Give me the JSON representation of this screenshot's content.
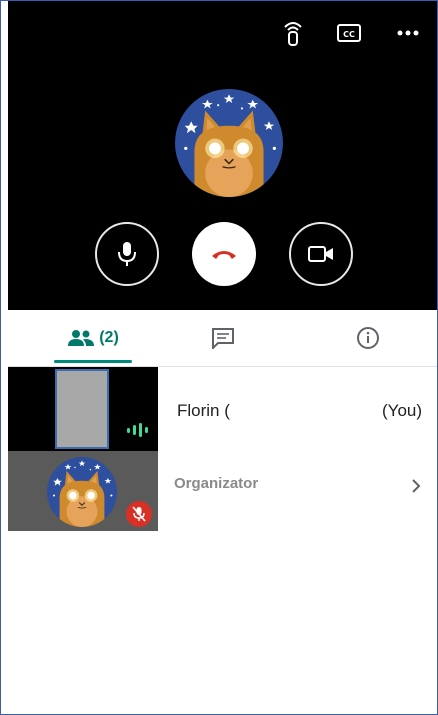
{
  "call": {
    "icons": [
      "live-stream-icon",
      "captions-icon",
      "more-icon"
    ],
    "controls": [
      "microphone-button",
      "end-call-button",
      "camera-button"
    ],
    "colors": {
      "background": "#000000",
      "end_call": "#d93025"
    }
  },
  "tabs": {
    "people_count": "(2)",
    "items": [
      "people",
      "chat",
      "info"
    ],
    "active_color": "#00897b"
  },
  "participants": {
    "self_name": "Florin (",
    "self_tag": "(You)",
    "other_role": "Organizator"
  }
}
